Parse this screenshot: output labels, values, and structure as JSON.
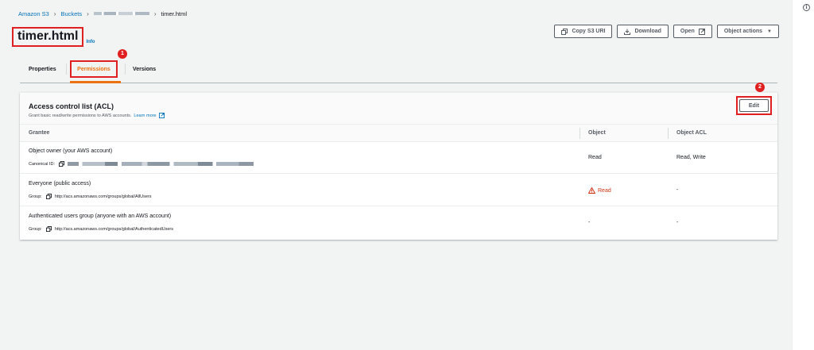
{
  "breadcrumb": {
    "root": "Amazon S3",
    "buckets": "Buckets",
    "current": "timer.html"
  },
  "header": {
    "title": "timer.html",
    "info": "Info"
  },
  "actions": {
    "copy_uri": "Copy S3 URI",
    "download": "Download",
    "open": "Open",
    "object_actions": "Object actions"
  },
  "tabs": [
    {
      "label": "Properties"
    },
    {
      "label": "Permissions"
    },
    {
      "label": "Versions"
    }
  ],
  "annotations": {
    "badge1": "1",
    "badge2": "2"
  },
  "acl": {
    "title": "Access control list (ACL)",
    "subtitle": "Grant basic read/write permissions to AWS accounts.",
    "learn_more": "Learn more",
    "edit": "Edit",
    "columns": [
      "Grantee",
      "Object",
      "Object ACL"
    ],
    "rows": [
      {
        "grantee": "Object owner (your AWS account)",
        "detail_label": "Canonical ID:",
        "detail_value": "",
        "object": "Read",
        "object_acl": "Read, Write"
      },
      {
        "grantee": "Everyone (public access)",
        "detail_label": "Group:",
        "detail_value": "http://acs.amazonaws.com/groups/global/AllUsers",
        "object": "Read",
        "object_acl": "-"
      },
      {
        "grantee": "Authenticated users group (anyone with an AWS account)",
        "detail_label": "Group:",
        "detail_value": "http://acs.amazonaws.com/groups/global/AuthenticatedUsers",
        "object": "-",
        "object_acl": "-"
      }
    ]
  },
  "colors": {
    "link": "#0073bb",
    "accent": "#ec7211",
    "warning": "#d13212",
    "annotation": "#e02020"
  },
  "icons": {
    "info": "info-circle-icon",
    "copy": "copy-icon",
    "download": "download-icon",
    "external": "external-link-icon",
    "warning": "warning-triangle-icon",
    "caret": "caret-down-icon"
  }
}
